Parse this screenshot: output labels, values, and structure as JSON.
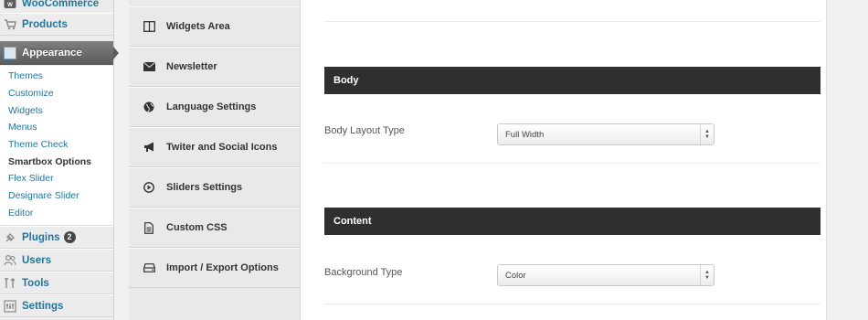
{
  "sidebar": {
    "woocommerce": "WooCommerce",
    "products": "Products",
    "appearance": "Appearance",
    "submenu": [
      {
        "label": "Themes"
      },
      {
        "label": "Customize"
      },
      {
        "label": "Widgets"
      },
      {
        "label": "Menus"
      },
      {
        "label": "Theme Check"
      },
      {
        "label": "Smartbox Options",
        "current": true
      },
      {
        "label": "Flex Slider"
      },
      {
        "label": "Designare Slider"
      },
      {
        "label": "Editor"
      }
    ],
    "plugins": "Plugins",
    "plugins_badge": "2",
    "users": "Users",
    "tools": "Tools",
    "settings": "Settings"
  },
  "options_nav": [
    {
      "label": "Widgets Area",
      "icon": "columns-icon"
    },
    {
      "label": "Newsletter",
      "icon": "envelope-icon"
    },
    {
      "label": "Language Settings",
      "icon": "globe-icon"
    },
    {
      "label": "Twiter and Social Icons",
      "icon": "megaphone-icon"
    },
    {
      "label": "Sliders Settings",
      "icon": "play-circle-icon"
    },
    {
      "label": "Custom CSS",
      "icon": "document-icon"
    },
    {
      "label": "Import / Export Options",
      "icon": "hard-drive-icon"
    }
  ],
  "content": {
    "body_section": {
      "title": "Body",
      "field_label": "Body Layout Type",
      "value": "Full Width"
    },
    "content_section": {
      "title": "Content",
      "field_label": "Background Type",
      "value": "Color"
    }
  },
  "colors": {
    "link": "#21759b",
    "section_bar": "#2f2f2f",
    "appearance_bg": "#6a6a6a"
  }
}
